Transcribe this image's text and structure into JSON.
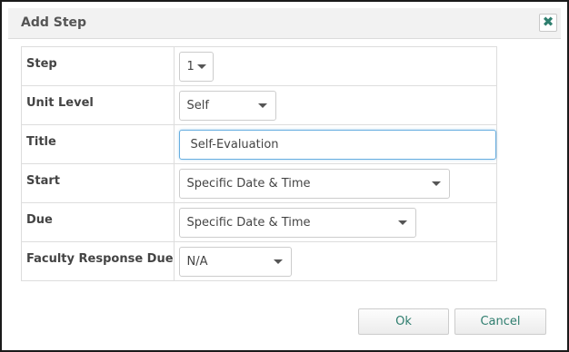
{
  "dialog": {
    "title": "Add Step",
    "close_symbol": "✖",
    "close_icon": "close-icon"
  },
  "form": {
    "rows": [
      {
        "label": "Step",
        "value": "1"
      },
      {
        "label": "Unit Level",
        "value": "Self"
      },
      {
        "label": "Title",
        "value": "Self-Evaluation"
      },
      {
        "label": "Start",
        "value": "Specific Date & Time"
      },
      {
        "label": "Due",
        "value": "Specific Date & Time"
      },
      {
        "label": "Faculty Response Due",
        "value": "N/A"
      }
    ]
  },
  "buttons": {
    "ok": "Ok",
    "cancel": "Cancel"
  },
  "colors": {
    "accent_text": "#2e7d6e",
    "focus_border": "#66aee0"
  }
}
